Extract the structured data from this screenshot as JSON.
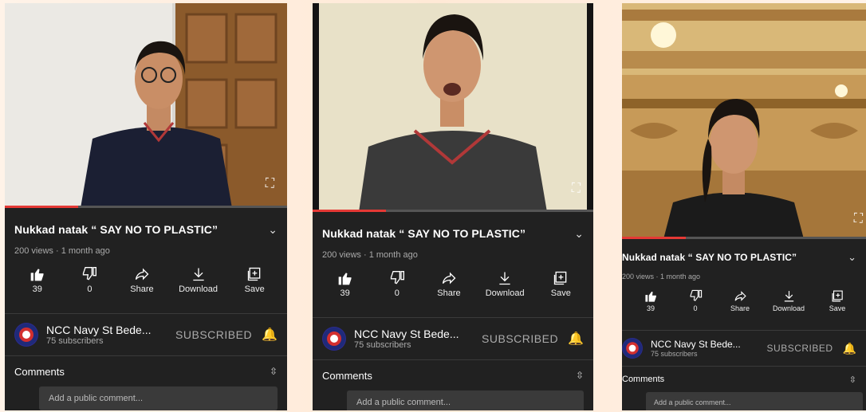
{
  "video": {
    "title": "Nukkad natak “ SAY NO TO PLASTIC”",
    "meta": "200 views · 1 month ago",
    "progress_fraction": 0.26
  },
  "actions": {
    "like_count": "39",
    "dislike_count": "0",
    "share_label": "Share",
    "download_label": "Download",
    "save_label": "Save"
  },
  "channel": {
    "name": "NCC Navy St Bede...",
    "subscribers": "75 subscribers",
    "subscribe_state": "SUBSCRIBED"
  },
  "comments": {
    "header": "Comments",
    "placeholder": "Add a public comment..."
  },
  "colors": {
    "background": "#212121",
    "accent": "#e53935",
    "muted_text": "#aaaaaa"
  },
  "icons": [
    "thumbs-up-icon",
    "thumbs-down-icon",
    "share-icon",
    "download-icon",
    "save-icon",
    "bell-icon",
    "chevron-down-icon",
    "unfold-icon",
    "fullscreen-icon"
  ]
}
